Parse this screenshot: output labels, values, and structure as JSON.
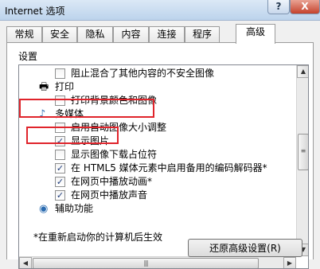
{
  "window": {
    "title": "Internet 选项",
    "help_label": "?",
    "close_label": "X"
  },
  "tabs": [
    {
      "label": "常规"
    },
    {
      "label": "安全"
    },
    {
      "label": "隐私"
    },
    {
      "label": "内容"
    },
    {
      "label": "连接"
    },
    {
      "label": "程序"
    },
    {
      "label": "高级",
      "active": true
    }
  ],
  "settings": {
    "section_label": "设置",
    "items": [
      {
        "kind": "checkbox",
        "checked": false,
        "label": "阻止混合了其他内容的不安全图像"
      },
      {
        "kind": "category",
        "icon": "printer-icon",
        "label": "打印"
      },
      {
        "kind": "checkbox",
        "checked": false,
        "label": "打印背景颜色和图像"
      },
      {
        "kind": "category",
        "icon": "multimedia-icon",
        "label": "多媒体"
      },
      {
        "kind": "checkbox",
        "checked": false,
        "label": "启用自动图像大小调整"
      },
      {
        "kind": "checkbox",
        "checked": true,
        "label": "显示图片"
      },
      {
        "kind": "checkbox",
        "checked": false,
        "label": "显示图像下载占位符"
      },
      {
        "kind": "checkbox",
        "checked": true,
        "label": "在 HTML5 媒体元素中启用备用的编码解码器*"
      },
      {
        "kind": "checkbox",
        "checked": true,
        "label": "在网页中播放动画*"
      },
      {
        "kind": "checkbox",
        "checked": true,
        "label": "在网页中播放声音"
      },
      {
        "kind": "category",
        "icon": "accessibility-icon",
        "label": "辅助功能"
      }
    ]
  },
  "footer": {
    "note": "*在重新启动你的计算机后生效",
    "restore_button_label": "还原高级设置(R)"
  },
  "colors": {
    "highlight_box": "#e0242b",
    "checkmark": "#1c3a7a"
  }
}
